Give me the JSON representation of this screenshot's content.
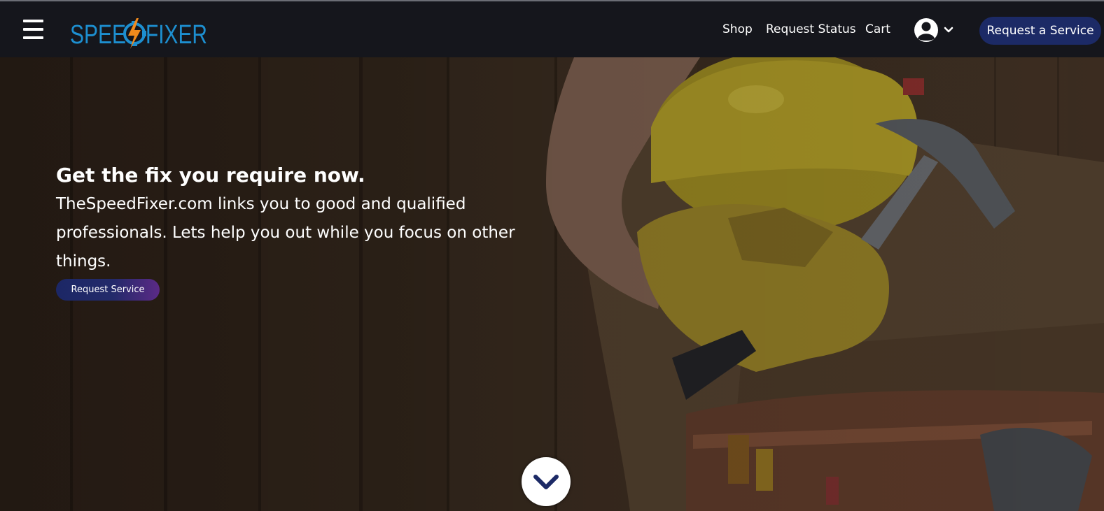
{
  "header": {
    "logo_text_left": "SPEE",
    "logo_text_right": "FIXER",
    "nav": {
      "shop": "Shop",
      "request_status": "Request Status",
      "cart": "Cart"
    },
    "cta_label": "Request a Service"
  },
  "hero": {
    "title": "Get the fix you require now.",
    "description": "TheSpeedFixer.com links you to good and qualified professionals. Lets help you out while you focus on other things.",
    "button_label": "Request Service"
  },
  "icons": {
    "menu": "hamburger-menu-icon",
    "account": "user-circle-icon",
    "account_caret": "chevron-down-icon",
    "scroll": "chevron-down-icon",
    "logo_mark": "lightning-gear-icon"
  },
  "colors": {
    "nav_bg": "#15161c",
    "logo_blue": "#1d8fd0",
    "logo_orange": "#f08a1c",
    "cta_blue": "#1c2a66",
    "gradient_purple": "#5b2a86",
    "hero_wood": "#2e231a"
  }
}
